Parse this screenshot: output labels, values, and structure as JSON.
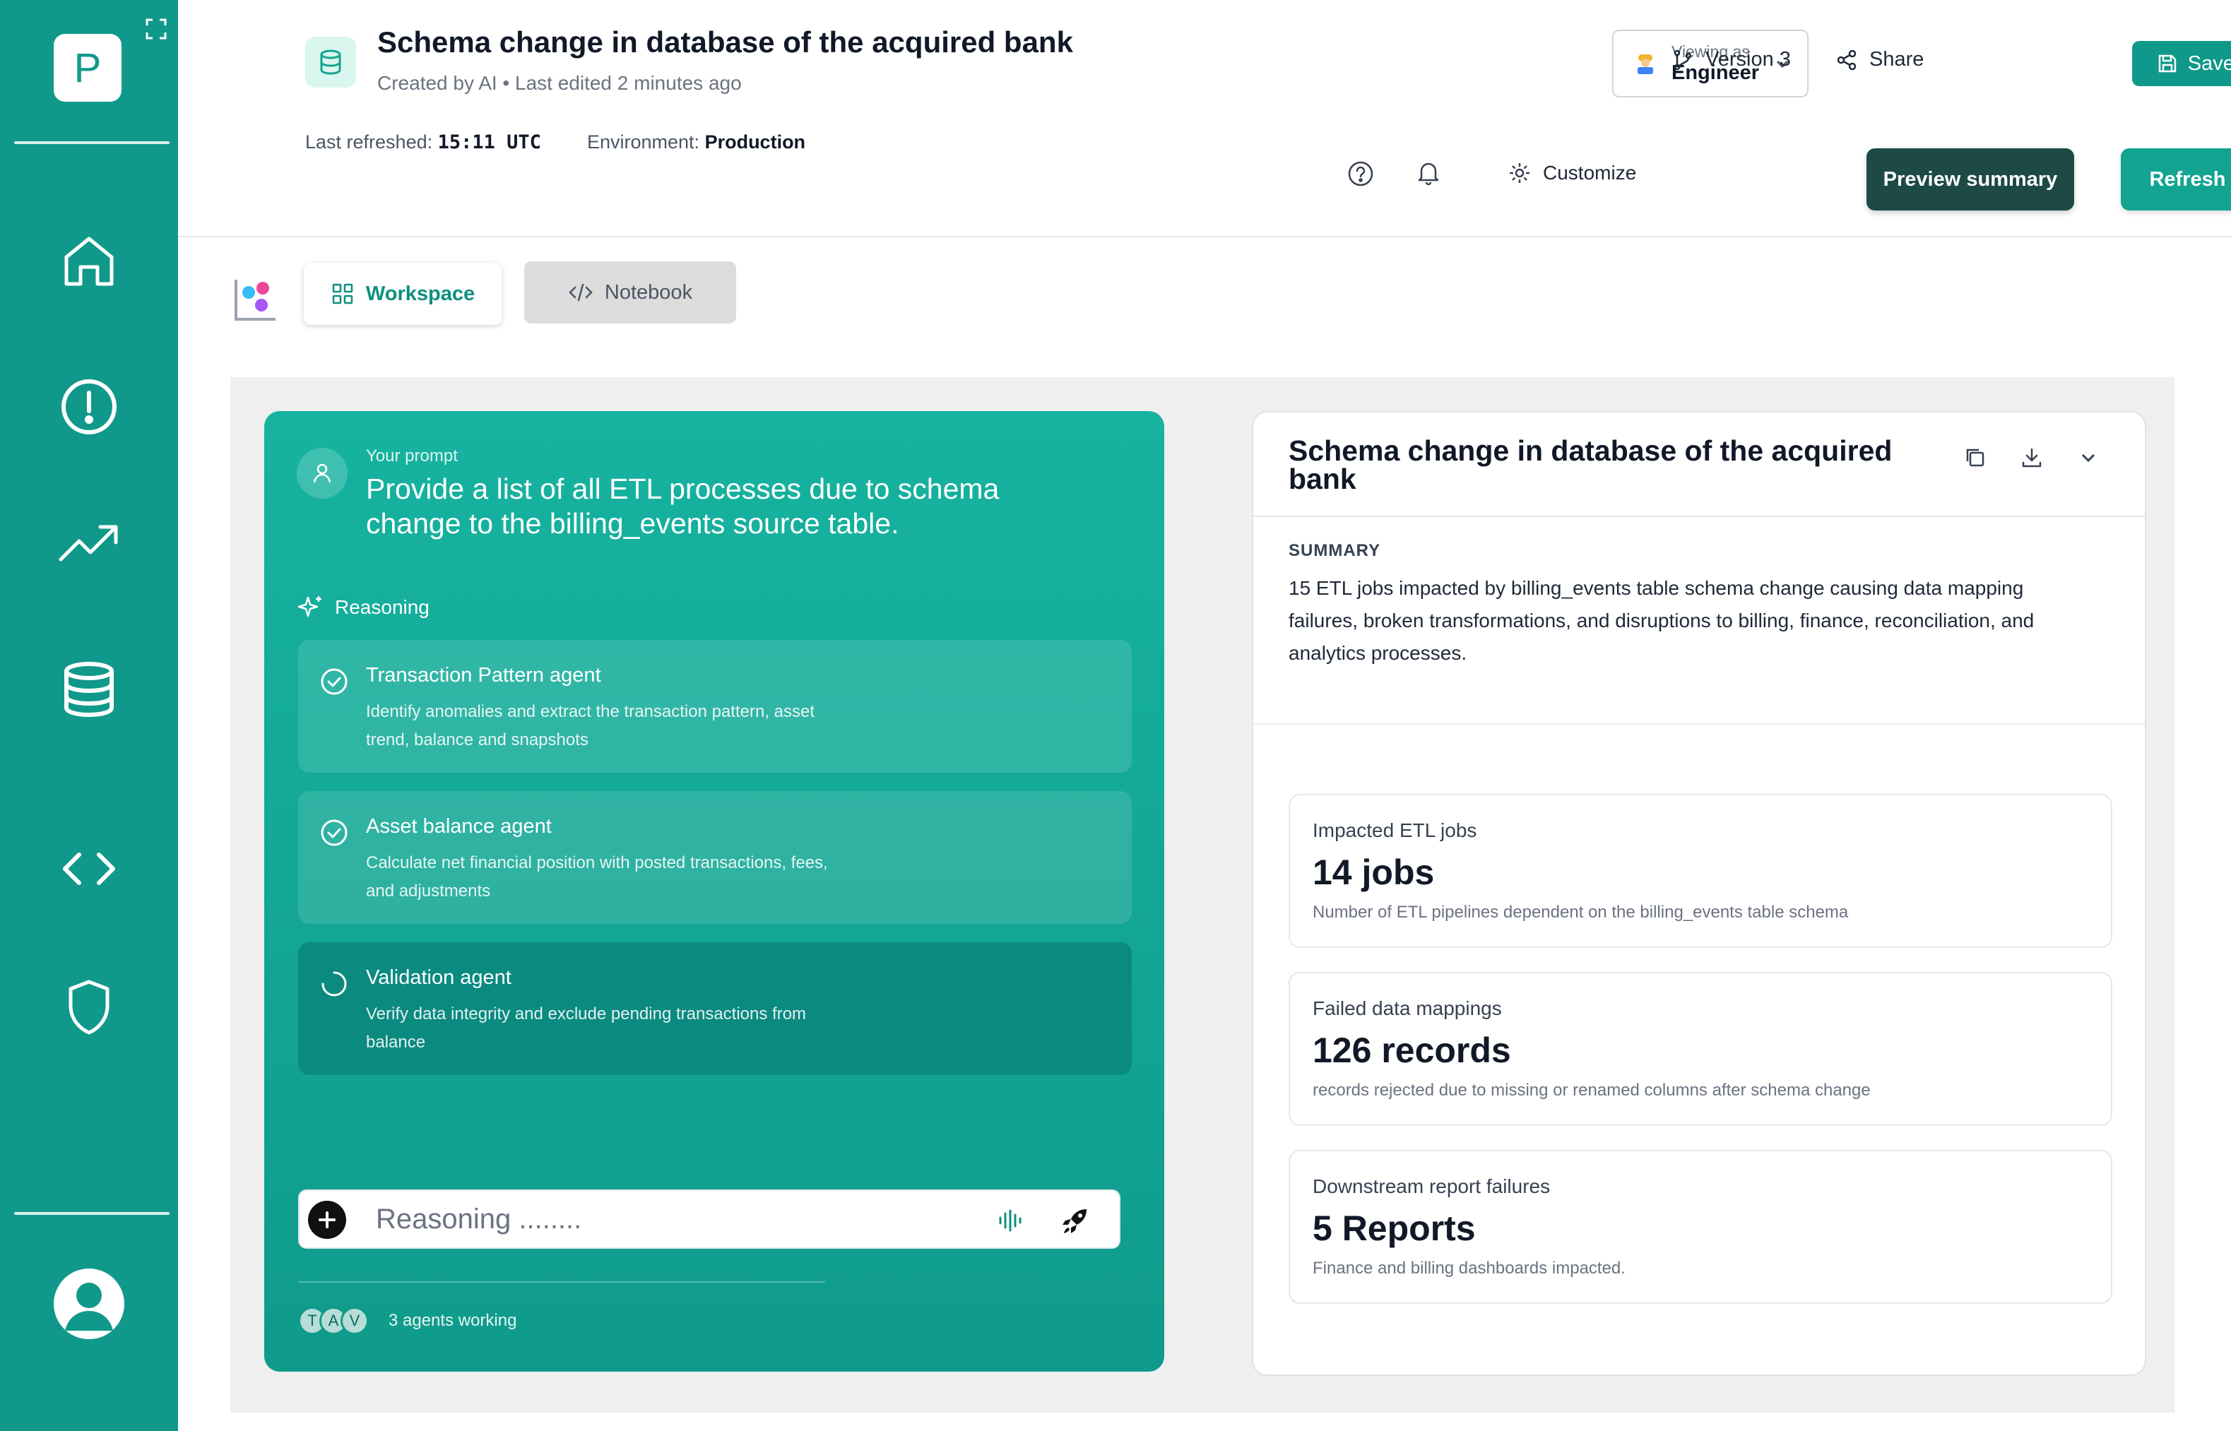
{
  "sidebar": {
    "logo_letter": "P",
    "items": [
      {
        "name": "home"
      },
      {
        "name": "alerts"
      },
      {
        "name": "trends"
      },
      {
        "name": "database"
      },
      {
        "name": "code"
      },
      {
        "name": "security"
      }
    ]
  },
  "header": {
    "title": "Schema change in database of the acquired bank",
    "meta": "Created by AI • Last edited 2 minutes ago",
    "last_refreshed_label": "Last refreshed:",
    "last_refreshed_value": "15:11 UTC",
    "environment_label": "Environment:",
    "environment_value": "Production",
    "viewing_as_label": "Viewing as",
    "viewing_as_value": "Engineer",
    "version_label": "Version 3",
    "share_label": "Share",
    "save_label": "Save Project",
    "customize_label": "Customize",
    "preview_label": "Preview summary",
    "refresh_label": "Refresh now →"
  },
  "tabs": [
    {
      "label": "Workspace",
      "active": true
    },
    {
      "label": "Notebook",
      "active": false
    }
  ],
  "prompt_panel": {
    "your_prompt_label": "Your prompt",
    "prompt_text": "Provide a list of all ETL processes due to schema change to the billing_events source table.",
    "reasoning_label": "Reasoning",
    "agents": [
      {
        "title": "Transaction Pattern agent",
        "description": "Identify anomalies and extract the transaction pattern, asset trend, balance and snapshots",
        "status": "done"
      },
      {
        "title": "Asset balance agent",
        "description": "Calculate net financial position with posted transactions, fees, and adjustments",
        "status": "done"
      },
      {
        "title": "Validation agent",
        "description": "Verify data integrity and exclude pending transactions from balance",
        "status": "running"
      }
    ],
    "input_placeholder": "Reasoning ........",
    "agent_initials": [
      "T",
      "A",
      "V"
    ],
    "agents_working": "3 agents working"
  },
  "summary_card": {
    "title": "Schema change in database of the acquired bank",
    "summary_label": "SUMMARY",
    "summary_text": "15 ETL jobs impacted by billing_events table schema change causing data mapping failures, broken transformations, and disruptions to billing, finance, reconciliation, and analytics processes.",
    "metrics": [
      {
        "label": "Impacted ETL jobs",
        "value": "14 jobs",
        "description": "Number of ETL pipelines dependent on the billing_events table schema"
      },
      {
        "label": "Failed data mappings",
        "value": "126 records",
        "description": "records rejected due to missing or renamed columns after schema change"
      },
      {
        "label": "Downstream report failures",
        "value": "5 Reports",
        "description": "Finance and billing dashboards impacted."
      }
    ]
  },
  "colors": {
    "brand": "#10998a",
    "dark_button": "#1d4a45",
    "active_agent": "#0b8a80"
  }
}
